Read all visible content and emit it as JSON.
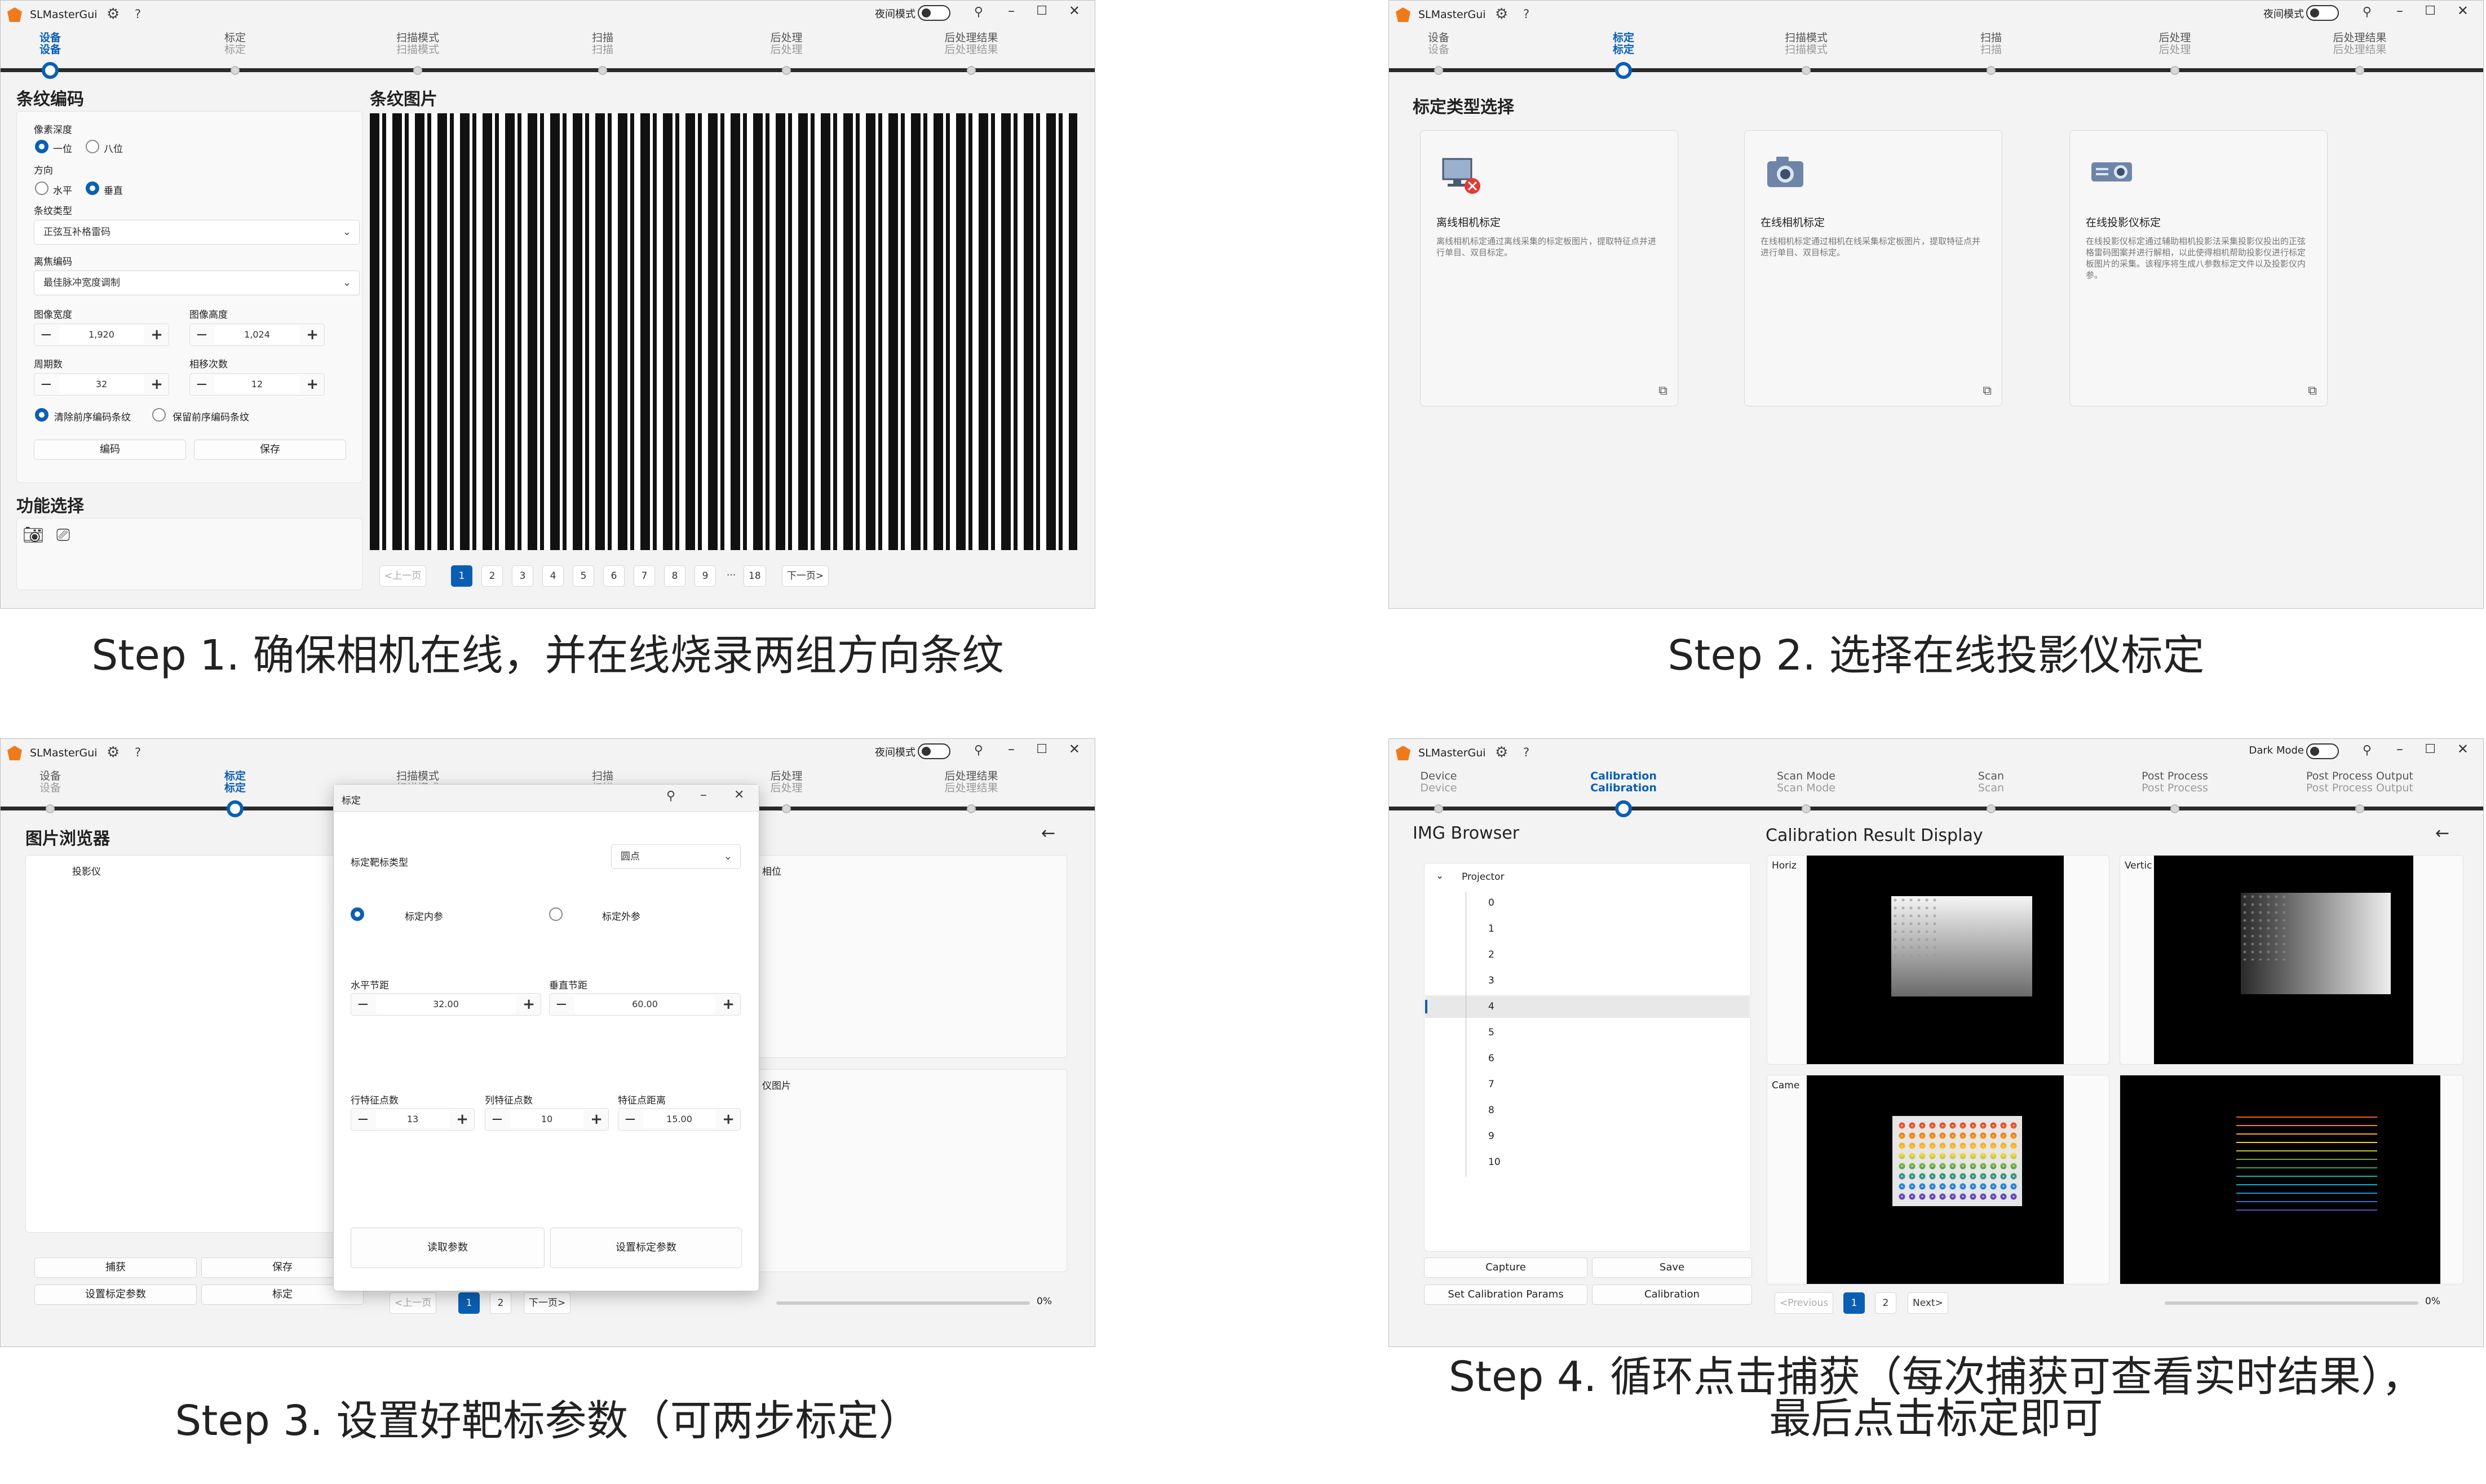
{
  "app_title": "SLMasterGui",
  "colors": {
    "accent": "#0a5fb4",
    "logo": "#f07a1a"
  },
  "steps_cn": [
    {
      "a": "设备",
      "b": "设备"
    },
    {
      "a": "标定",
      "b": "标定"
    },
    {
      "a": "扫描模式",
      "b": "扫描模式"
    },
    {
      "a": "扫描",
      "b": "扫描"
    },
    {
      "a": "后处理",
      "b": "后处理"
    },
    {
      "a": "后处理结果",
      "b": "后处理结果"
    }
  ],
  "steps_en": [
    {
      "a": "Device",
      "b": "Device"
    },
    {
      "a": "Calibration",
      "b": "Calibration"
    },
    {
      "a": "Scan Mode",
      "b": "Scan Mode"
    },
    {
      "a": "Scan",
      "b": "Scan"
    },
    {
      "a": "Post Process",
      "b": "Post Process"
    },
    {
      "a": "Post Process Output",
      "b": "Post Process Output"
    }
  ],
  "night_mode_cn": "夜间模式",
  "night_mode_en": "Dark Mode",
  "captions": {
    "s1": "Step 1. 确保相机在线，并在线烧录两组方向条纹",
    "s2": "Step 2. 选择在线投影仪标定",
    "s3": "Step 3. 设置好靶标参数（可两步标定）",
    "s4a": "Step 4. 循环点击捕获（每次捕获可查看实时结果），",
    "s4b": "最后点击标定即可"
  },
  "w1": {
    "coding_title": "条纹编码",
    "pixel_depth": "像素深度",
    "one_bit": "一位",
    "eight_bit": "八位",
    "direction": "方向",
    "horizontal": "水平",
    "vertical": "垂直",
    "stripe_type": "条纹类型",
    "stripe_type_value": "正弦互补格雷码",
    "defocus": "离焦编码",
    "defocus_value": "最佳脉冲宽度调制",
    "img_width": "图像宽度",
    "img_width_value": "1,920",
    "img_height": "图像高度",
    "img_height_value": "1,024",
    "period": "周期数",
    "period_value": "32",
    "shift": "相移次数",
    "shift_value": "12",
    "clear_prev": "清除前序编码条纹",
    "keep_prev": "保留前序编码条纹",
    "encode_btn": "编码",
    "save_btn": "保存",
    "func_title": "功能选择",
    "image_title": "条纹图片",
    "prev": "<上一页",
    "next": "下一页>",
    "pages": [
      "1",
      "2",
      "3",
      "4",
      "5",
      "6",
      "7",
      "8",
      "9",
      "18"
    ],
    "ellipsis": "···"
  },
  "w2": {
    "title": "标定类型选择",
    "cards": [
      {
        "title": "离线相机标定",
        "desc": "离线相机标定通过离线采集的标定板图片，提取特征点并进行单目、双目标定。"
      },
      {
        "title": "在线相机标定",
        "desc": "在线相机标定通过相机在线采集标定板图片，提取特征点并进行单目、双目标定。"
      },
      {
        "title": "在线投影仪标定",
        "desc": "在线投影仪标定通过辅助相机投影法采集投影仪投出的正弦格雷码图案并进行解相，以此使得相机帮助投影仪进行标定板图片的采集。该程序将生成八参数标定文件以及投影仪内参。"
      }
    ]
  },
  "w3": {
    "browser_title": "图片浏览器",
    "projector": "投影仪",
    "phase_lbl": "相位",
    "proj_img_lbl": "仪图片",
    "capture": "捕获",
    "save": "保存",
    "set_params": "设置标定参数",
    "calibrate": "标定",
    "prev": "<上一页",
    "next": "下一页>",
    "pages": [
      "1",
      "2"
    ],
    "progress": "0%",
    "dialog": {
      "title": "标定",
      "target_type": "标定靶标类型",
      "target_value": "圆点",
      "intrinsic": "标定内参",
      "extrinsic": "标定外参",
      "h_pitch": "水平节距",
      "h_pitch_value": "32.00",
      "v_pitch": "垂直节距",
      "v_pitch_value": "60.00",
      "rows": "行特征点数",
      "rows_value": "13",
      "cols": "列特征点数",
      "cols_value": "10",
      "dist": "特征点距离",
      "dist_value": "15.00",
      "read_btn": "读取参数",
      "set_btn": "设置标定参数"
    }
  },
  "w4": {
    "browser_title": "IMG Browser",
    "result_title": "Calibration Result Display",
    "tree_root": "Projector",
    "tree_items": [
      "0",
      "1",
      "2",
      "3",
      "4",
      "5",
      "6",
      "7",
      "8",
      "9",
      "10"
    ],
    "selected_index": 4,
    "lbl_h": "Horiz",
    "lbl_v": "Vertic",
    "lbl_c": "Came",
    "capture": "Capture",
    "save": "Save",
    "set_params": "Set Calibration Params",
    "calibrate": "Calibration",
    "prev": "<Previous",
    "next": "Next>",
    "pages": [
      "1",
      "2"
    ],
    "progress": "0%"
  }
}
